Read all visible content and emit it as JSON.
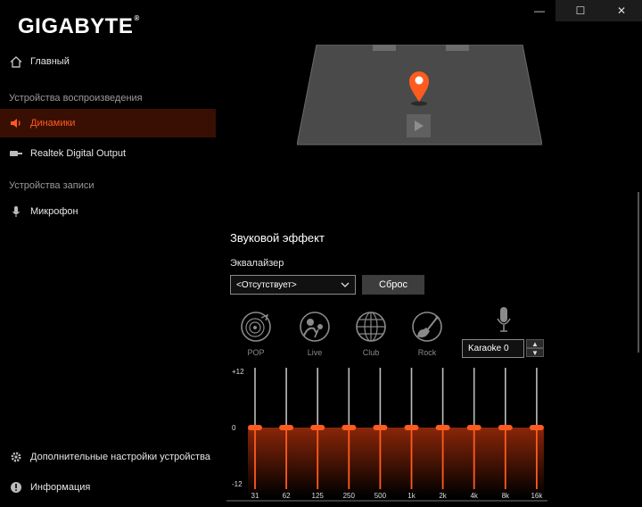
{
  "app": {
    "logo": "GIGABYTE",
    "logo_mark": "®"
  },
  "window_controls": {
    "minimize": "—",
    "maximize": "☐",
    "close": "✕"
  },
  "sidebar": {
    "home": "Главный",
    "playback_section": "Устройства воспроизведения",
    "speakers": "Динамики",
    "digital_output": "Realtek Digital Output",
    "record_section": "Устройства записи",
    "microphone": "Микрофон",
    "advanced_settings": "Дополнительные настройки устройства",
    "info": "Информация"
  },
  "main": {
    "section_title": "Звуковой эффект",
    "equalizer_label": "Эквалайзер",
    "equalizer_value": "<Отсутствует>",
    "reset_label": "Сброс",
    "presets": [
      "POP",
      "Live",
      "Club",
      "Rock"
    ],
    "karaoke_value": "Karaoke 0"
  },
  "colors": {
    "accent": "#ff5b1f",
    "active_bg": "#3a0f03",
    "preset_icon": "#8a8a8a"
  },
  "icons": {
    "home": "home-icon",
    "speakers": "speaker-icon",
    "digital_output": "digital-output-icon",
    "microphone": "microphone-icon",
    "advanced": "gear-icon",
    "info": "info-icon",
    "play": "play-icon",
    "location": "location-pin-icon"
  },
  "equalizer": {
    "y_tick_labels": [
      "+12",
      "0",
      "-12"
    ],
    "bands": [
      {
        "freq": "31",
        "gain": 0
      },
      {
        "freq": "62",
        "gain": 0
      },
      {
        "freq": "125",
        "gain": 0
      },
      {
        "freq": "250",
        "gain": 0
      },
      {
        "freq": "500",
        "gain": 0
      },
      {
        "freq": "1k",
        "gain": 0
      },
      {
        "freq": "2k",
        "gain": 0
      },
      {
        "freq": "4k",
        "gain": 0
      },
      {
        "freq": "8k",
        "gain": 0
      },
      {
        "freq": "16k",
        "gain": 0
      }
    ],
    "range": [
      -12,
      12
    ]
  }
}
